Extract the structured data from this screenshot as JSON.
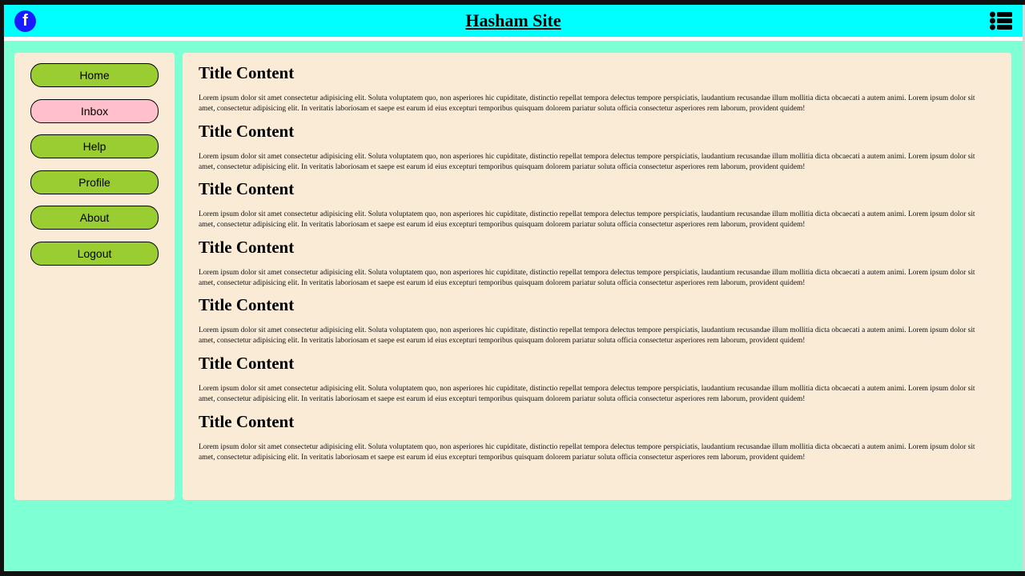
{
  "header": {
    "title": "Hasham Site",
    "left_icon": "facebook-icon",
    "left_icon_glyph": "f",
    "right_icon": "list-menu-icon"
  },
  "colors": {
    "header_bg": "#00ffff",
    "page_bg": "#7fffd4",
    "panel_bg": "#faebd7",
    "button_green": "#9acd32",
    "button_pink": "#ffc0cb",
    "facebook_blue": "#1a1aff"
  },
  "sidebar": {
    "items": [
      {
        "label": "Home",
        "color": "#9acd32"
      },
      {
        "label": "Inbox",
        "color": "#ffc0cb"
      },
      {
        "label": "Help",
        "color": "#9acd32"
      },
      {
        "label": "Profile",
        "color": "#9acd32"
      },
      {
        "label": "About",
        "color": "#9acd32"
      },
      {
        "label": "Logout",
        "color": "#9acd32"
      }
    ]
  },
  "main": {
    "sections": [
      {
        "title": "Title Content",
        "text": "Lorem ipsum dolor sit amet consectetur adipisicing elit. Soluta voluptatem quo, non asperiores hic cupiditate, distinctio repellat tempora delectus tempore perspiciatis, laudantium recusandae illum mollitia dicta obcaecati a autem animi. Lorem ipsum dolor sit amet, consectetur adipisicing elit. In veritatis laboriosam et saepe est earum id eius excepturi temporibus quisquam dolorem pariatur soluta officia consectetur asperiores rem laborum, provident quidem!"
      },
      {
        "title": "Title Content",
        "text": "Lorem ipsum dolor sit amet consectetur adipisicing elit. Soluta voluptatem quo, non asperiores hic cupiditate, distinctio repellat tempora delectus tempore perspiciatis, laudantium recusandae illum mollitia dicta obcaecati a autem animi. Lorem ipsum dolor sit amet, consectetur adipisicing elit. In veritatis laboriosam et saepe est earum id eius excepturi temporibus quisquam dolorem pariatur soluta officia consectetur asperiores rem laborum, provident quidem!"
      },
      {
        "title": "Title Content",
        "text": "Lorem ipsum dolor sit amet consectetur adipisicing elit. Soluta voluptatem quo, non asperiores hic cupiditate, distinctio repellat tempora delectus tempore perspiciatis, laudantium recusandae illum mollitia dicta obcaecati a autem animi. Lorem ipsum dolor sit amet, consectetur adipisicing elit. In veritatis laboriosam et saepe est earum id eius excepturi temporibus quisquam dolorem pariatur soluta officia consectetur asperiores rem laborum, provident quidem!"
      },
      {
        "title": "Title Content",
        "text": "Lorem ipsum dolor sit amet consectetur adipisicing elit. Soluta voluptatem quo, non asperiores hic cupiditate, distinctio repellat tempora delectus tempore perspiciatis, laudantium recusandae illum mollitia dicta obcaecati a autem animi. Lorem ipsum dolor sit amet, consectetur adipisicing elit. In veritatis laboriosam et saepe est earum id eius excepturi temporibus quisquam dolorem pariatur soluta officia consectetur asperiores rem laborum, provident quidem!"
      },
      {
        "title": "Title Content",
        "text": "Lorem ipsum dolor sit amet consectetur adipisicing elit. Soluta voluptatem quo, non asperiores hic cupiditate, distinctio repellat tempora delectus tempore perspiciatis, laudantium recusandae illum mollitia dicta obcaecati a autem animi. Lorem ipsum dolor sit amet, consectetur adipisicing elit. In veritatis laboriosam et saepe est earum id eius excepturi temporibus quisquam dolorem pariatur soluta officia consectetur asperiores rem laborum, provident quidem!"
      },
      {
        "title": "Title Content",
        "text": "Lorem ipsum dolor sit amet consectetur adipisicing elit. Soluta voluptatem quo, non asperiores hic cupiditate, distinctio repellat tempora delectus tempore perspiciatis, laudantium recusandae illum mollitia dicta obcaecati a autem animi. Lorem ipsum dolor sit amet, consectetur adipisicing elit. In veritatis laboriosam et saepe est earum id eius excepturi temporibus quisquam dolorem pariatur soluta officia consectetur asperiores rem laborum, provident quidem!"
      },
      {
        "title": "Title Content",
        "text": "Lorem ipsum dolor sit amet consectetur adipisicing elit. Soluta voluptatem quo, non asperiores hic cupiditate, distinctio repellat tempora delectus tempore perspiciatis, laudantium recusandae illum mollitia dicta obcaecati a autem animi. Lorem ipsum dolor sit amet, consectetur adipisicing elit. In veritatis laboriosam et saepe est earum id eius excepturi temporibus quisquam dolorem pariatur soluta officia consectetur asperiores rem laborum, provident quidem!"
      }
    ]
  }
}
